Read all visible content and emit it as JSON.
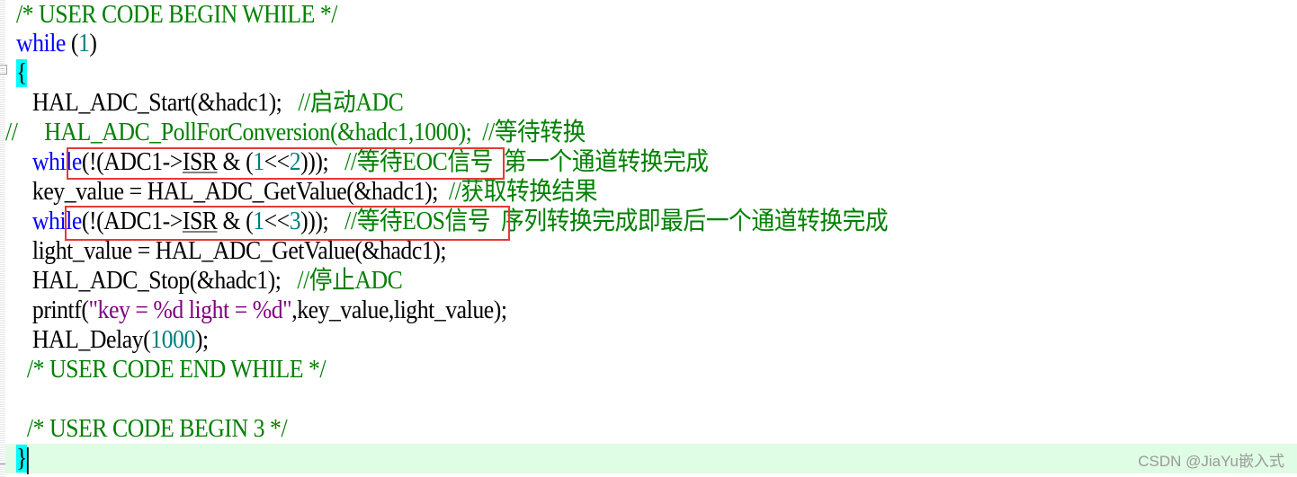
{
  "editor": {
    "lines": [
      {
        "indent": "  ",
        "parts": [
          {
            "t": "/* USER CODE BEGIN WHILE */",
            "c": "cm"
          }
        ]
      },
      {
        "indent": "  ",
        "parts": [
          {
            "t": "while",
            "c": "kw"
          },
          {
            "t": " (",
            "c": "pl"
          },
          {
            "t": "1",
            "c": "num"
          },
          {
            "t": ")",
            "c": "pl"
          }
        ]
      },
      {
        "indent": "  ",
        "parts": [
          {
            "t": "{",
            "c": "brace"
          }
        ]
      },
      {
        "indent": "     ",
        "parts": [
          {
            "t": "HAL_ADC_Start(&hadc1);   ",
            "c": "pl"
          },
          {
            "t": "//启动ADC",
            "c": "cm"
          }
        ]
      },
      {
        "indent": "",
        "parts": [
          {
            "t": "//     HAL_ADC_PollForConversion(&hadc1,1000);  //等待转换",
            "c": "cm"
          }
        ]
      },
      {
        "indent": "     ",
        "parts": [
          {
            "t": "while",
            "c": "kw"
          },
          {
            "t": "(!(ADC1->",
            "c": "pl"
          },
          {
            "t": "ISR",
            "c": "pl ul"
          },
          {
            "t": " & (",
            "c": "pl"
          },
          {
            "t": "1",
            "c": "num"
          },
          {
            "t": "<<",
            "c": "pl"
          },
          {
            "t": "2",
            "c": "num"
          },
          {
            "t": ")));   ",
            "c": "pl"
          },
          {
            "t": "//等待EOC信号  第一个通道转换完成",
            "c": "cm"
          }
        ]
      },
      {
        "indent": "     ",
        "parts": [
          {
            "t": "key_value = HAL_ADC_GetValue(&hadc1);  ",
            "c": "pl"
          },
          {
            "t": "//获取转换结果",
            "c": "cm"
          }
        ]
      },
      {
        "indent": "     ",
        "parts": [
          {
            "t": "while",
            "c": "kw"
          },
          {
            "t": "(!(ADC1->",
            "c": "pl"
          },
          {
            "t": "ISR",
            "c": "pl ul"
          },
          {
            "t": " & (",
            "c": "pl"
          },
          {
            "t": "1",
            "c": "num"
          },
          {
            "t": "<<",
            "c": "pl"
          },
          {
            "t": "3",
            "c": "num"
          },
          {
            "t": ")));   ",
            "c": "pl"
          },
          {
            "t": "//等待EOS信号  序列转换完成即最后一个通道转换完成",
            "c": "cm"
          }
        ]
      },
      {
        "indent": "     ",
        "parts": [
          {
            "t": "light_value = HAL_ADC_GetValue(&hadc1);",
            "c": "pl"
          }
        ]
      },
      {
        "indent": "     ",
        "parts": [
          {
            "t": "HAL_ADC_Stop(&hadc1);   ",
            "c": "pl"
          },
          {
            "t": "//停止ADC",
            "c": "cm"
          }
        ]
      },
      {
        "indent": "     ",
        "parts": [
          {
            "t": "printf(",
            "c": "pl"
          },
          {
            "t": "\"key = %d light = %d\"",
            "c": "str"
          },
          {
            "t": ",key_value,light_value);",
            "c": "pl"
          }
        ]
      },
      {
        "indent": "     ",
        "parts": [
          {
            "t": "HAL_Delay(",
            "c": "pl"
          },
          {
            "t": "1000",
            "c": "num"
          },
          {
            "t": ");",
            "c": "pl"
          }
        ]
      },
      {
        "indent": "    ",
        "parts": [
          {
            "t": "/* USER CODE END WHILE */",
            "c": "cm"
          }
        ]
      },
      {
        "indent": "",
        "parts": []
      },
      {
        "indent": "    ",
        "parts": [
          {
            "t": "/* USER CODE BEGIN 3 */",
            "c": "cm"
          }
        ]
      },
      {
        "indent": "  ",
        "parts": [
          {
            "t": "}",
            "c": "brace"
          }
        ],
        "current": true
      }
    ],
    "highlighted_lines": [
      5,
      7
    ]
  },
  "watermark": "CSDN @JiaYu嵌入式"
}
